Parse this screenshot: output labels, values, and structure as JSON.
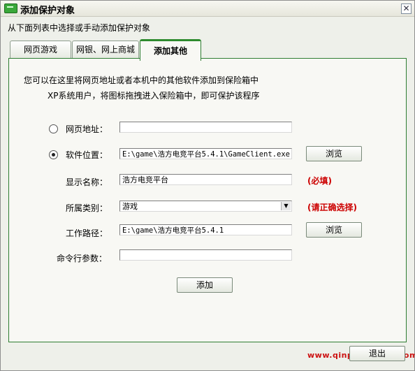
{
  "window": {
    "title": "添加保护对象",
    "close_glyph": "✕",
    "subtitle": "从下面列表中选择或手动添加保护对象"
  },
  "tabs": [
    {
      "label": "网页游戏"
    },
    {
      "label": "网银、网上商城"
    },
    {
      "label": "添加其他",
      "selected": true
    }
  ],
  "panel": {
    "desc_line1": "您可以在这里将网页地址或者本机中的其他软件添加到保险箱中",
    "desc_line2": "XP系统用户，将图标拖拽进入保险箱中，即可保护该程序"
  },
  "form": {
    "url": {
      "label": "网页地址：",
      "value": "",
      "selected": false
    },
    "software": {
      "label": "软件位置：",
      "value": "E:\\game\\浩方电竞平台5.4.1\\GameClient.exe",
      "selected": true,
      "browse_label": "浏览"
    },
    "display_name": {
      "label": "显示名称：",
      "value": "浩方电竞平台",
      "note": "(必填)"
    },
    "category": {
      "label": "所属类别：",
      "value": "游戏",
      "note": "(请正确选择)"
    },
    "work_path": {
      "label": "工作路径：",
      "value": "E:\\game\\浩方电竞平台5.4.1",
      "browse_label": "浏览"
    },
    "cmd_args": {
      "label": "命令行参数：",
      "value": ""
    },
    "add_label": "添加"
  },
  "footer": {
    "exit_label": "退出",
    "watermark": "www.qinpinchuang.com"
  },
  "colors": {
    "accent_green": "#2e8b2e",
    "note_red": "#cc0000"
  }
}
